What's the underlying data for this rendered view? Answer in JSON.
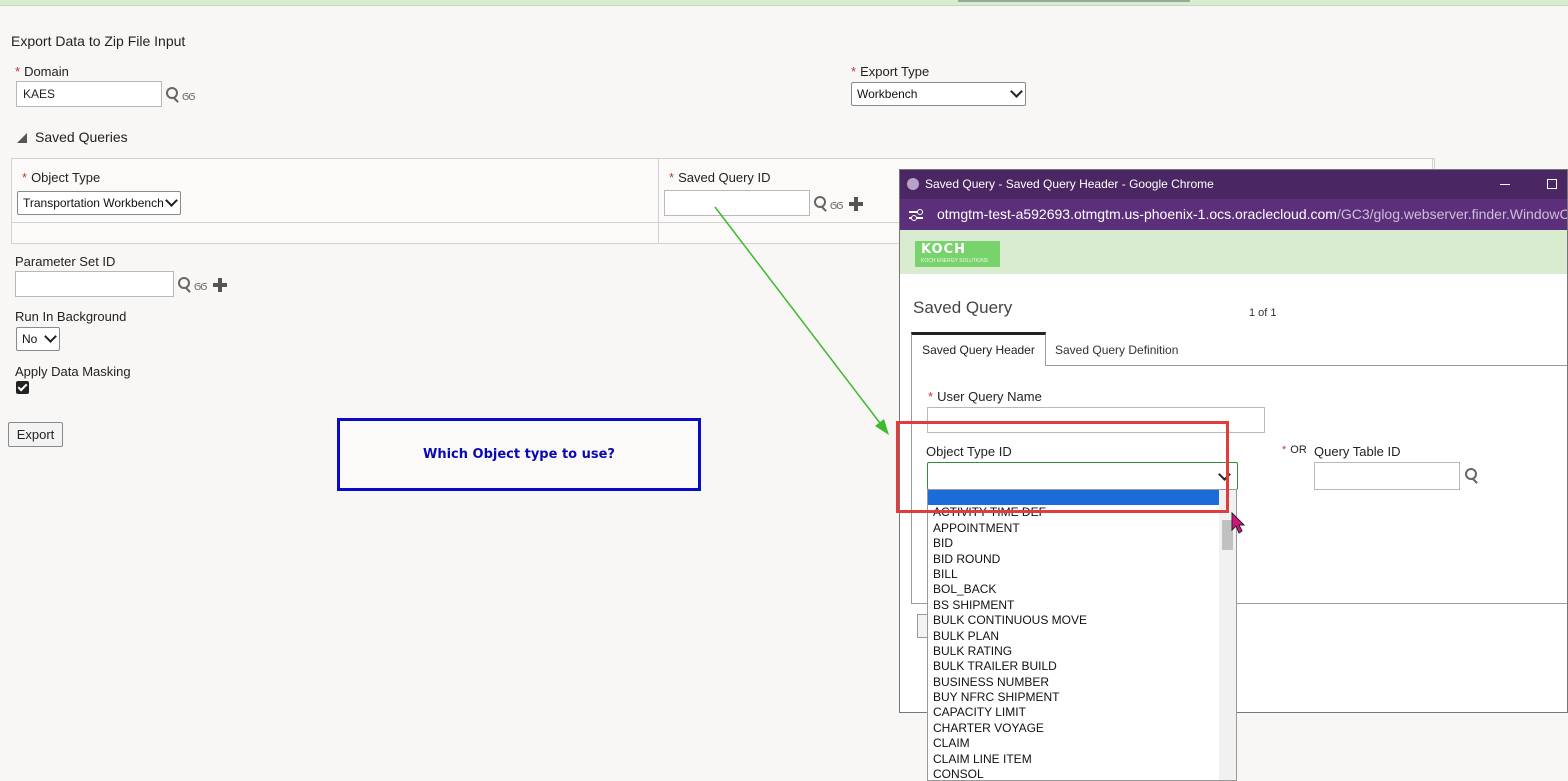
{
  "page": {
    "title": "Export Data to Zip File Input",
    "domain": {
      "label": "Domain",
      "value": "KAES"
    },
    "export_type": {
      "label": "Export Type",
      "value": "Workbench"
    },
    "saved_queries": {
      "section_label": "Saved Queries",
      "object_type": {
        "label": "Object Type",
        "value": "Transportation Workbench"
      },
      "saved_query_id": {
        "label": "Saved Query ID",
        "value": ""
      }
    },
    "parameter_set_id": {
      "label": "Parameter Set ID",
      "value": ""
    },
    "run_in_background": {
      "label": "Run In Background",
      "value": "No"
    },
    "apply_data_masking": {
      "label": "Apply Data Masking",
      "checked": true
    },
    "export_button": "Export",
    "callout_text": "Which Object type to use?"
  },
  "popup": {
    "window_title": "Saved Query - Saved Query Header - Google Chrome",
    "url_host": "otmgtm-test-a592693.otmgtm.us-phoenix-1.ocs.oraclecloud.com",
    "url_path": "/GC3/glog.webserver.finder.WindowC",
    "logo_text": "KOCH",
    "logo_subtext": "KOCH ENERGY SOLUTIONS",
    "panel_title": "Saved Query",
    "paging": "1 of 1",
    "tabs": [
      {
        "label": "Saved Query Header",
        "active": true
      },
      {
        "label": "Saved Query Definition",
        "active": false
      }
    ],
    "user_query_name": {
      "label": "User Query Name",
      "value": ""
    },
    "object_type_id": {
      "label": "Object Type ID",
      "value": ""
    },
    "or_label": "OR",
    "query_table_id": {
      "label": "Query Table ID",
      "value": ""
    },
    "dropdown_options": [
      "ACTIVITY TIME DEF",
      "APPOINTMENT",
      "BID",
      "BID ROUND",
      "BILL",
      "BOL_BACK",
      "BS SHIPMENT",
      "BULK CONTINUOUS MOVE",
      "BULK PLAN",
      "BULK RATING",
      "BULK TRAILER BUILD",
      "BUSINESS NUMBER",
      "BUY NFRC SHIPMENT",
      "CAPACITY LIMIT",
      "CHARTER VOYAGE",
      "CLAIM",
      "CLAIM LINE ITEM",
      "CONSOL"
    ]
  },
  "colors": {
    "titlebar": "#4a2663",
    "urlbar": "#5c2f7b",
    "callout_border": "#0a0acb",
    "highlight_box": "#e03c3c",
    "arrow": "#3cba2c",
    "dropdown_selected": "#1b6bd8",
    "koch_green": "#79d36c"
  }
}
